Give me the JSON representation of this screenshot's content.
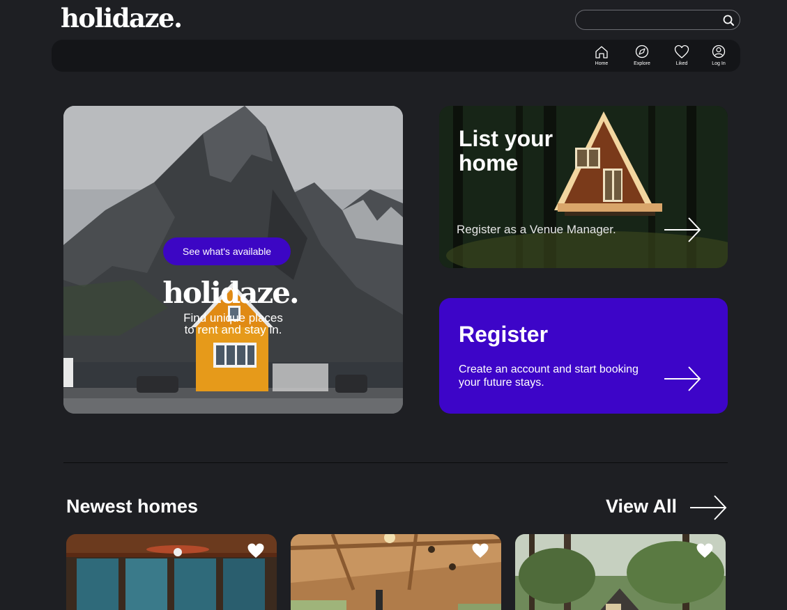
{
  "app": {
    "logo": "holidaze."
  },
  "search": {
    "placeholder": "",
    "value": ""
  },
  "nav": {
    "items": [
      {
        "label": "Home",
        "icon": "home-icon"
      },
      {
        "label": "Explore",
        "icon": "compass-icon"
      },
      {
        "label": "Liked",
        "icon": "heart-icon"
      },
      {
        "label": "Log In",
        "icon": "user-icon"
      }
    ]
  },
  "hero": {
    "logo": "holidaze.",
    "subtitle_line1": "Find unique places",
    "subtitle_line2": "to rent and stay in.",
    "cta": "See what's available"
  },
  "list_card": {
    "title": "List your home",
    "subtitle": "Register as a Venue Manager."
  },
  "register_card": {
    "title": "Register",
    "subtitle": "Create an account and start booking your future stays."
  },
  "newest": {
    "title": "Newest homes",
    "view_all": "View All"
  },
  "colors": {
    "background": "#1e1f23",
    "navbar": "#141518",
    "accent": "#3d05c8"
  }
}
